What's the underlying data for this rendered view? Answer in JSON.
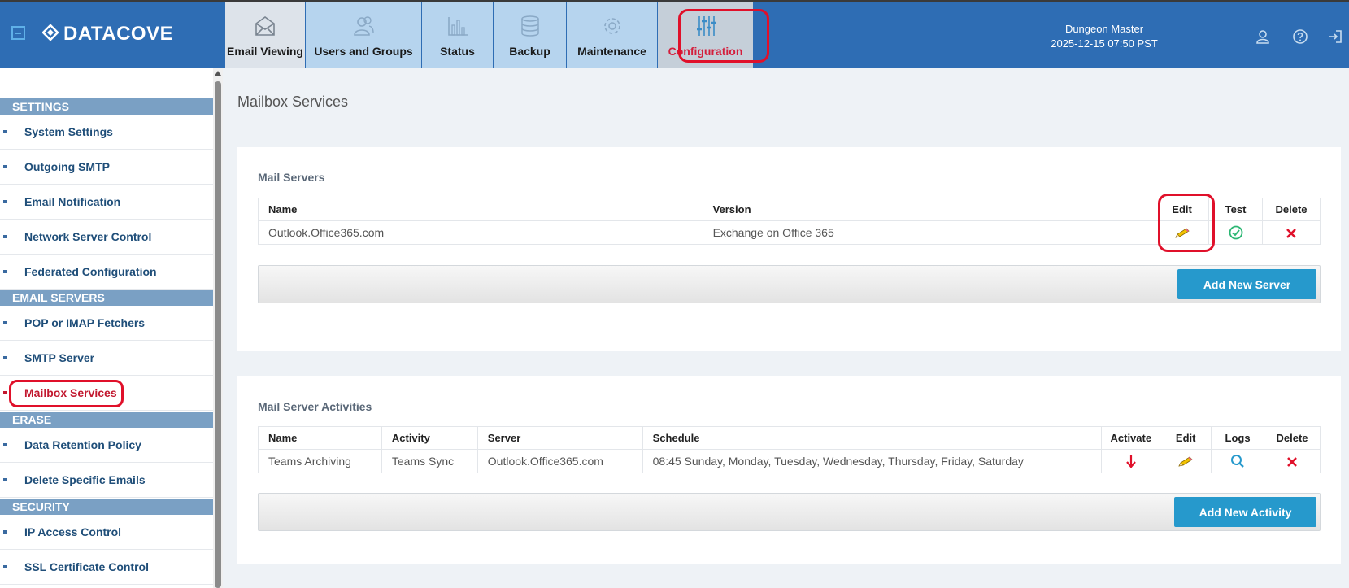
{
  "app": {
    "name": "DATACOVE"
  },
  "nav": {
    "tabs": [
      {
        "label": "Email Viewing",
        "icon": "envelope-icon"
      },
      {
        "label": "Users and Groups",
        "icon": "users-icon"
      },
      {
        "label": "Status",
        "icon": "bar-chart-icon"
      },
      {
        "label": "Backup",
        "icon": "database-icon"
      },
      {
        "label": "Maintenance",
        "icon": "gear-icon"
      },
      {
        "label": "Configuration",
        "icon": "sliders-icon",
        "active": true
      }
    ]
  },
  "user": {
    "name": "Dungeon Master",
    "datetime": "2025-12-15 07:50 PST"
  },
  "header_icons": [
    "user-icon",
    "help-icon",
    "logout-icon"
  ],
  "sidebar": {
    "sections": [
      {
        "title": "SETTINGS",
        "items": [
          "System Settings",
          "Outgoing SMTP",
          "Email Notification",
          "Network Server Control",
          "Federated Configuration"
        ]
      },
      {
        "title": "EMAIL SERVERS",
        "items": [
          "POP or IMAP Fetchers",
          "SMTP Server",
          "Mailbox Services"
        ]
      },
      {
        "title": "ERASE",
        "items": [
          "Data Retention Policy",
          "Delete Specific Emails"
        ]
      },
      {
        "title": "SECURITY",
        "items": [
          "IP Access Control",
          "SSL Certificate Control"
        ]
      }
    ],
    "active_item": "Mailbox Services"
  },
  "main": {
    "page_title": "Mailbox Services",
    "mail_servers": {
      "title": "Mail Servers",
      "columns": [
        "Name",
        "Version",
        "Edit",
        "Test",
        "Delete"
      ],
      "rows": [
        {
          "name": "Outlook.Office365.com",
          "version": "Exchange on Office 365"
        }
      ],
      "add_button": "Add New Server"
    },
    "activities": {
      "title": "Mail Server Activities",
      "columns": [
        "Name",
        "Activity",
        "Server",
        "Schedule",
        "Activate",
        "Edit",
        "Logs",
        "Delete"
      ],
      "rows": [
        {
          "name": "Teams Archiving",
          "activity": "Teams Sync",
          "server": "Outlook.Office365.com",
          "schedule": "08:45 Sunday, Monday, Tuesday, Wednesday, Thursday, Friday, Saturday"
        }
      ],
      "add_button": "Add New Activity"
    }
  },
  "colors": {
    "header_bg": "#2e6db4",
    "tab_bg": "#b6d4ee",
    "active_text": "#c2182f",
    "sidebar_section": "#7aa0c4",
    "primary_button": "#2699cc",
    "test_ok": "#2bb673",
    "delete_red": "#e0102a"
  }
}
